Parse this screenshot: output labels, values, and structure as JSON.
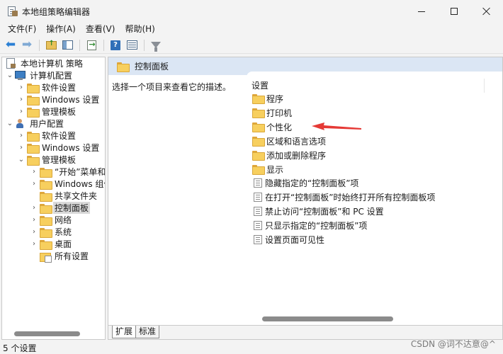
{
  "window": {
    "title": "本地组策略编辑器"
  },
  "menu": [
    "文件(F)",
    "操作(A)",
    "查看(V)",
    "帮助(H)"
  ],
  "tree": {
    "items": [
      {
        "label": "本地计算机 策略",
        "icon": "policy-icon",
        "chevron": ""
      },
      {
        "label": "计算机配置",
        "icon": "computer-icon",
        "chevron": "⌄"
      },
      {
        "label": "软件设置",
        "icon": "folder-icon",
        "chevron": "›"
      },
      {
        "label": "Windows 设置",
        "icon": "folder-icon",
        "chevron": "›"
      },
      {
        "label": "管理模板",
        "icon": "folder-icon",
        "chevron": "›"
      },
      {
        "label": "用户配置",
        "icon": "user-icon",
        "chevron": "⌄"
      },
      {
        "label": "软件设置",
        "icon": "folder-icon",
        "chevron": "›"
      },
      {
        "label": "Windows 设置",
        "icon": "folder-icon",
        "chevron": "›"
      },
      {
        "label": "管理模板",
        "icon": "folder-icon",
        "chevron": "⌄"
      },
      {
        "label": "“开始”菜单和任务栏",
        "icon": "folder-icon",
        "chevron": "›"
      },
      {
        "label": "Windows 组件",
        "icon": "folder-icon",
        "chevron": "›"
      },
      {
        "label": "共享文件夹",
        "icon": "folder-icon",
        "chevron": ""
      },
      {
        "label": "控制面板",
        "icon": "folder-icon",
        "chevron": "›"
      },
      {
        "label": "网络",
        "icon": "folder-icon",
        "chevron": "›"
      },
      {
        "label": "系统",
        "icon": "folder-icon",
        "chevron": "›"
      },
      {
        "label": "桌面",
        "icon": "folder-icon",
        "chevron": "›"
      },
      {
        "label": "所有设置",
        "icon": "all-settings-icon",
        "chevron": ""
      }
    ],
    "selected_index": 12
  },
  "details": {
    "header_title": "控制面板",
    "description": "选择一个项目来查看它的描述。",
    "column_header": "设置",
    "items": [
      {
        "label": "程序",
        "type": "folder"
      },
      {
        "label": "打印机",
        "type": "folder"
      },
      {
        "label": "个性化",
        "type": "folder"
      },
      {
        "label": "区域和语言选项",
        "type": "folder"
      },
      {
        "label": "添加或删除程序",
        "type": "folder"
      },
      {
        "label": "显示",
        "type": "folder"
      },
      {
        "label": "隐藏指定的“控制面板”项",
        "type": "setting"
      },
      {
        "label": "在打开“控制面板”时始终打开所有控制面板项",
        "type": "setting"
      },
      {
        "label": "禁止访问“控制面板”和 PC 设置",
        "type": "setting"
      },
      {
        "label": "只显示指定的“控制面板”项",
        "type": "setting"
      },
      {
        "label": "设置页面可见性",
        "type": "setting"
      }
    ],
    "tabs": [
      "扩展",
      "标准"
    ],
    "active_tab": "扩展"
  },
  "annotation": {
    "color": "#e53935",
    "points_to": "个性化"
  },
  "status": {
    "text": "5 个设置"
  },
  "watermark": "CSDN @词不达意@^"
}
